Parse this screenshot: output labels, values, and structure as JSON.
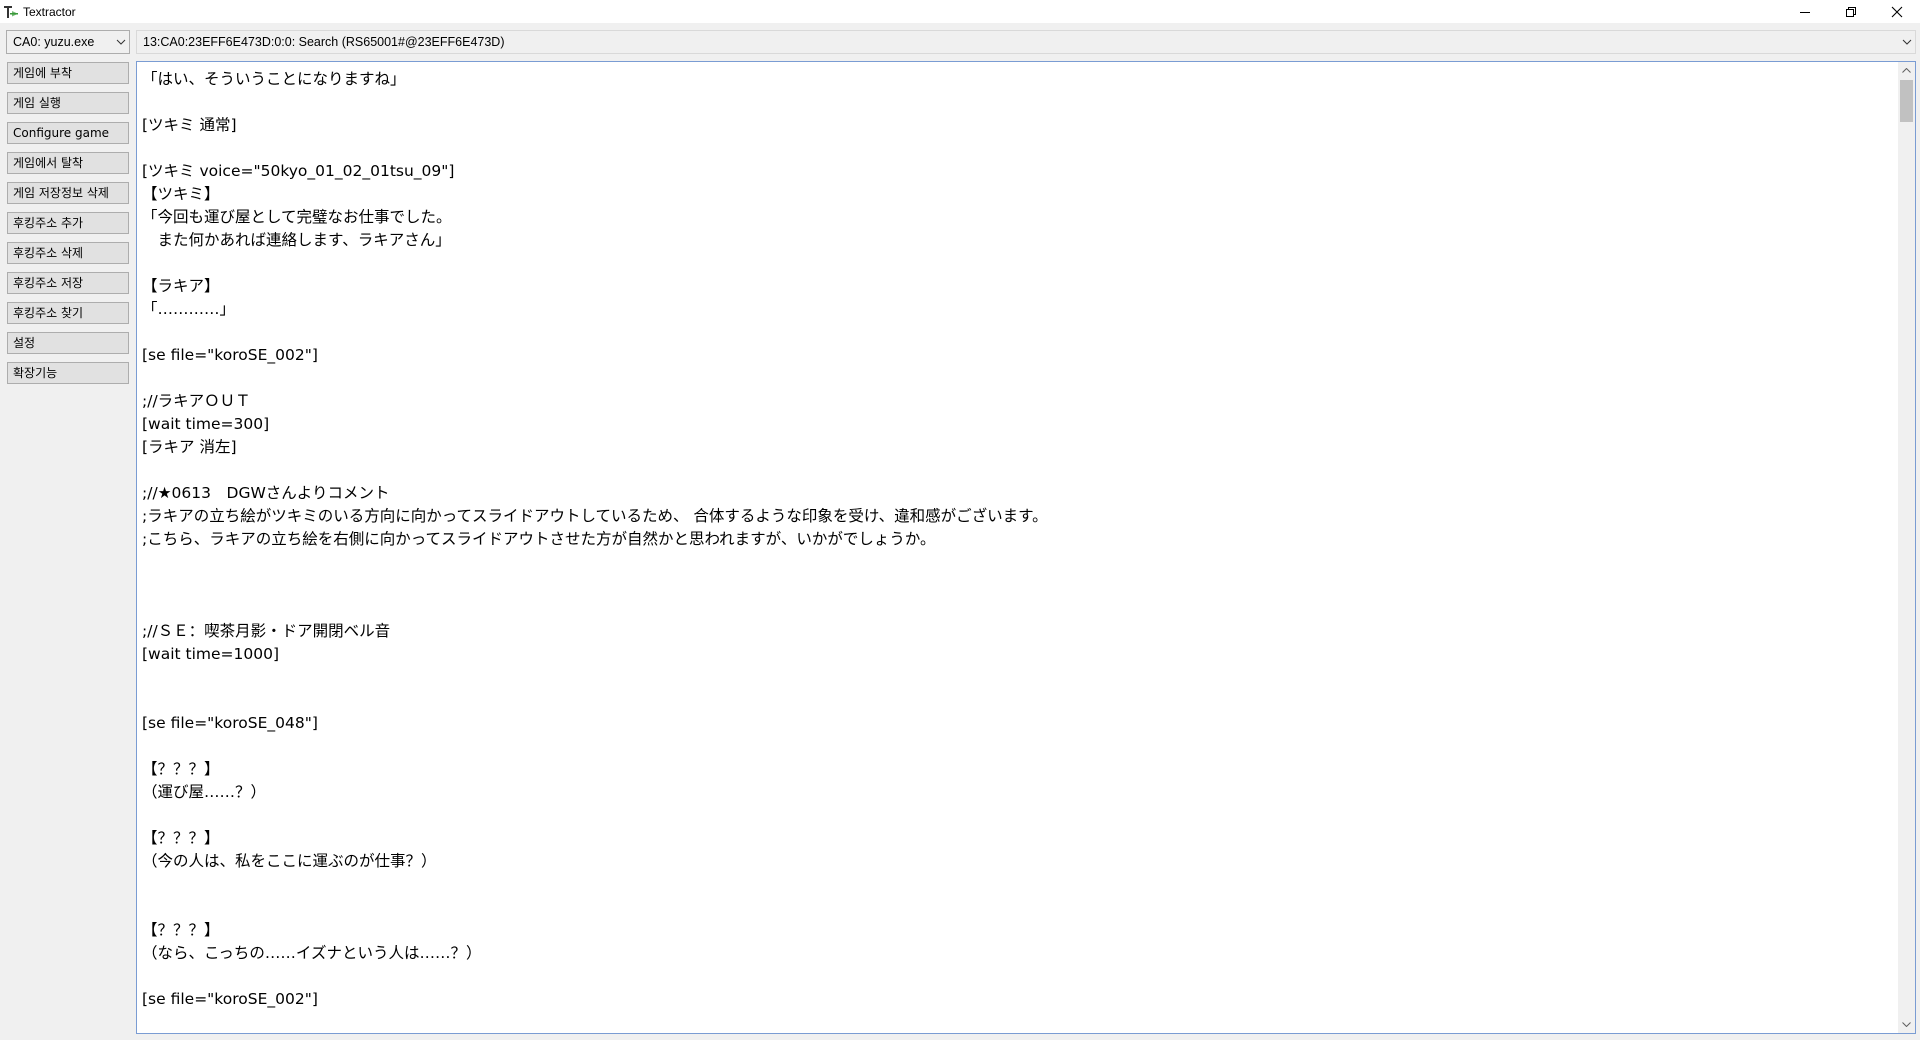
{
  "window": {
    "title": "Textractor"
  },
  "process_combo": {
    "value": "CA0: yuzu.exe"
  },
  "thread_combo": {
    "value": "13:CA0:23EFF6E473D:0:0: Search (RS65001#@23EFF6E473D)"
  },
  "sidebar": {
    "buttons": [
      {
        "label": "게임에 부착"
      },
      {
        "label": "게임 실행"
      },
      {
        "label": "Configure game"
      },
      {
        "label": "게임에서 탈착"
      },
      {
        "label": "게임 저장정보 삭제"
      },
      {
        "label": "후킹주소 추가"
      },
      {
        "label": "후킹주소 삭제"
      },
      {
        "label": "후킹주소 저장"
      },
      {
        "label": "후킹주소 찾기"
      },
      {
        "label": "설정"
      },
      {
        "label": "확장기능"
      }
    ]
  },
  "text": {
    "lines": [
      "「はい、そういうことになりますね」",
      "",
      "[ツキミ 通常]",
      "",
      "[ツキミ voice=\"50kyo_01_02_01tsu_09\"]",
      "【ツキミ】",
      "「今回も運び屋として完璧なお仕事でした。",
      "　また何かあれば連絡します、ラキアさん」",
      "",
      "【ラキア】",
      "「…………」",
      "",
      "[se file=\"koroSE_002\"]",
      "",
      ";//ラキアＯＵＴ",
      "[wait time=300]",
      "[ラキア 消左]",
      "",
      ";//★0613　DGWさんよりコメント",
      ";ラキアの立ち絵がツキミのいる方向に向かってスライドアウトしているため、 合体するような印象を受け、違和感がございます。",
      ";こちら、ラキアの立ち絵を右側に向かってスライドアウトさせた方が自然かと思われますが、いかがでしょうか。",
      "",
      "",
      "",
      ";//ＳＥ：喫茶月影・ドア開閉ベル音",
      "[wait time=1000]",
      "",
      "",
      "[se file=\"koroSE_048\"]",
      "",
      "【？？？】",
      "（運び屋……？）",
      "",
      "【？？？】",
      "（今の人は、私をここに運ぶのが仕事？）",
      "",
      "",
      "【？？？】",
      "（なら、こっちの……イズナという人は……？）",
      "",
      "[se file=\"koroSE_002\"]"
    ]
  },
  "icons": {
    "app": "textractor-logo-icon",
    "minimize": "minimize-icon",
    "restore": "restore-icon",
    "close": "close-icon",
    "dropdown": "chevron-down-icon"
  },
  "colors": {
    "window_bg": "#f0f0f0",
    "textarea_border": "#7a9cd3",
    "button_bg": "#e1e1e1",
    "button_border": "#adadad",
    "logo_green": "#3a9a3a"
  }
}
